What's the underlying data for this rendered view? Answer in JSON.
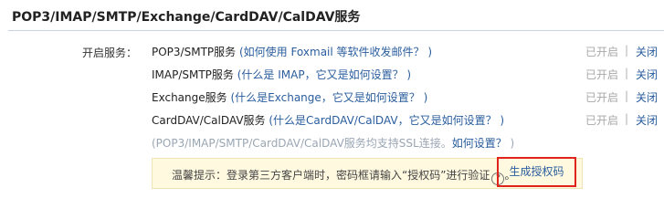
{
  "header": {
    "title": "POP3/IMAP/SMTP/Exchange/CardDAV/CalDAV服务"
  },
  "services": {
    "label": "开启服务：",
    "rows": [
      {
        "name": "POP3/SMTP服务",
        "help_prefix": " (",
        "help": "如何使用 Foxmail 等软件收发邮件？",
        "help_suffix": " )",
        "status": "已开启",
        "separator": "|",
        "close": "关闭"
      },
      {
        "name": "IMAP/SMTP服务",
        "help_prefix": " (",
        "help": "什么是 IMAP，它又是如何设置？",
        "help_suffix": " )",
        "status": "已开启",
        "separator": "|",
        "close": "关闭"
      },
      {
        "name": "Exchange服务",
        "help_prefix": " (",
        "help": "什么是Exchange，它又是如何设置？",
        "help_suffix": " )",
        "status": "已开启",
        "separator": "|",
        "close": "关闭"
      },
      {
        "name": "CardDAV/CalDAV服务",
        "help_prefix": " (",
        "help": "什么是CardDAV/CalDAV，它又是如何设置？",
        "help_suffix": " )",
        "status": "已开启",
        "separator": "|",
        "close": "关闭"
      }
    ],
    "ssl_note_prefix": "(POP3/IMAP/SMTP/CardDAV/CalDAV服务均支持SSL连接。",
    "ssl_link": "如何设置？",
    "ssl_note_suffix": " )"
  },
  "tip": {
    "text": "温馨提示：登录第三方客户端时，密码框请输入“授权码”进行验证",
    "help_icon": "?",
    "dot": "。",
    "generate_button": "生成授权码"
  }
}
